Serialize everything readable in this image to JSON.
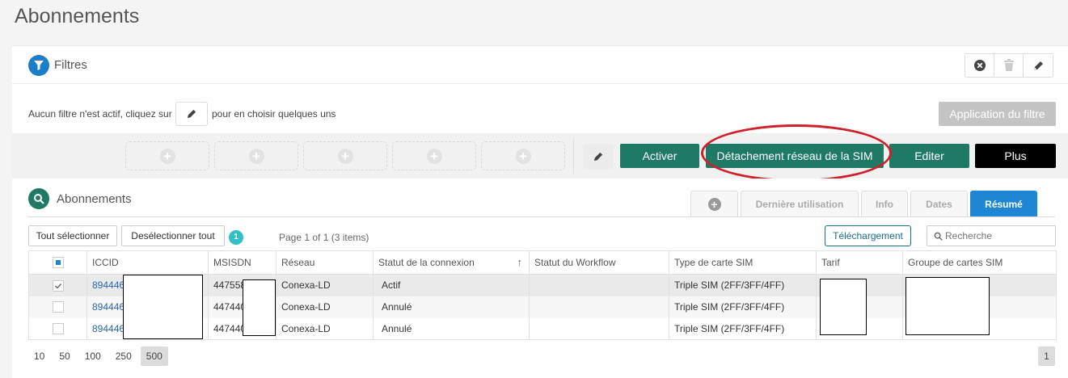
{
  "page": {
    "title": "Abonnements"
  },
  "filters": {
    "title": "Filtres",
    "info_before": "Aucun filtre n'est actif, cliquez sur",
    "info_after": "pour en choisir quelques uns",
    "apply_label": "Application du filtre"
  },
  "actions": {
    "activate": "Activer",
    "detach": "Détachement réseau de la SIM",
    "edit": "Editer",
    "more": "Plus"
  },
  "subscriptions": {
    "title": "Abonnements",
    "tabs": [
      "Dernière utilisation",
      "Info",
      "Dates",
      "Résumé"
    ],
    "select_all": "Tout sélectionner",
    "deselect_all": "Desélectionner tout",
    "selected_count": "1",
    "page_info": "Page 1 of 1 (3 items)",
    "download": "Téléchargement",
    "search_placeholder": "Recherche",
    "columns": [
      "ICCID",
      "MSISDN",
      "Réseau",
      "Statut de la connexion",
      "Statut du Workflow",
      "Type de carte SIM",
      "Tarif",
      "Groupe de cartes SIM"
    ],
    "rows": [
      {
        "iccid": "894446",
        "msisdn": "447558",
        "network": "Conexa-LD",
        "conn_status": "Actif",
        "workflow": "",
        "sim_type": "Triple SIM (2FF/3FF/4FF)",
        "tarif": "",
        "group": "",
        "checked": true
      },
      {
        "iccid": "894446",
        "msisdn": "447440",
        "network": "Conexa-LD",
        "conn_status": "Annulé",
        "workflow": "",
        "sim_type": "Triple SIM (2FF/3FF/4FF)",
        "tarif": "",
        "group": "",
        "checked": false
      },
      {
        "iccid": "894446",
        "msisdn": "447440",
        "network": "Conexa-LD",
        "conn_status": "Annulé",
        "workflow": "",
        "sim_type": "Triple SIM (2FF/3FF/4FF)",
        "tarif": "",
        "group": "",
        "checked": false
      }
    ],
    "page_sizes": [
      "10",
      "50",
      "100",
      "250",
      "500"
    ],
    "current_page": "1"
  },
  "colors": {
    "primary_green": "#1e7a64",
    "accent_blue": "#1e86d4",
    "highlight_red": "#d0202a"
  }
}
